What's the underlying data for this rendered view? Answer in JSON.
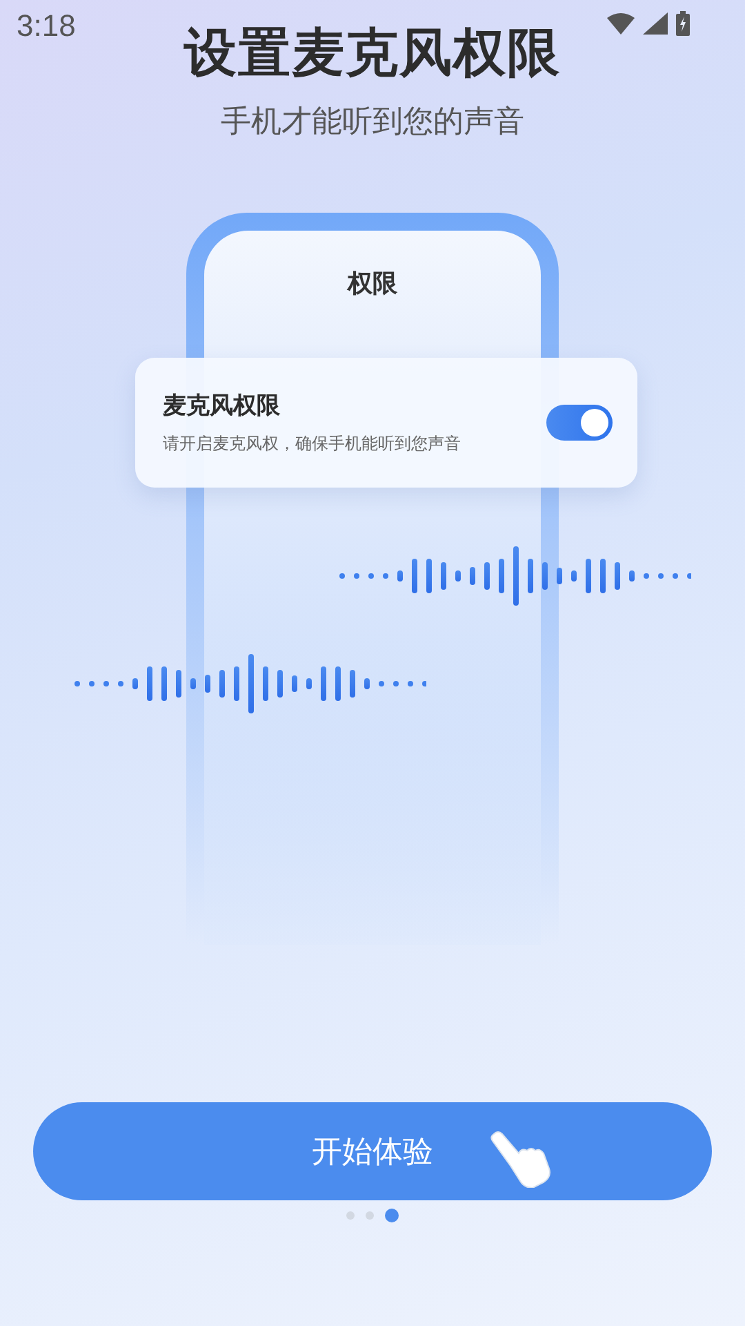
{
  "status_bar": {
    "time": "3:18"
  },
  "title": "设置麦克风权限",
  "subtitle": "手机才能听到您的声音",
  "phone": {
    "title": "权限"
  },
  "permission_card": {
    "title": "麦克风权限",
    "description": "请开启麦克风权，确保手机能听到您声音",
    "toggle": {
      "on": true
    }
  },
  "start_button": {
    "label": "开始体验"
  },
  "pager": [
    {
      "selected": false
    },
    {
      "selected": false
    },
    {
      "selected": true
    }
  ]
}
